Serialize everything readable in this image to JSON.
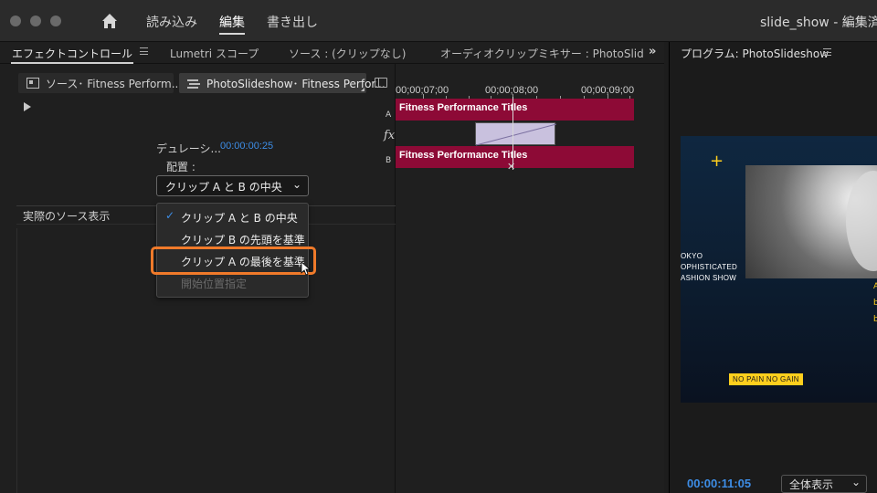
{
  "titlebar": {
    "menu": [
      "読み込み",
      "編集",
      "書き出し"
    ],
    "active_menu": "編集",
    "document_title": "slide_show - 編集済み"
  },
  "panel_tabs": {
    "effect_controls": "エフェクトコントロール",
    "lumetri": "Lumetri スコープ",
    "source": "ソース : (クリップなし)",
    "audio_mixer": "オーディオクリップミキサー : PhotoSlides"
  },
  "program": {
    "title": "プログラム: PhotoSlideshow",
    "timecode": "00:00:11:05",
    "zoom": "全体表示",
    "video_text": {
      "line1": "OKYO",
      "line2": "OPHISTICATED",
      "line3": "ASHION SHOW",
      "right1": "A",
      "right2": "b",
      "right3": "b",
      "badge": "NO PAIN NO GAIN"
    }
  },
  "effect_controls": {
    "source_tab": "ソース･ Fitness Perform...",
    "sequence_tab": "PhotoSlideshow･ Fitness Perfor...",
    "duration_label": "デュレーシ...",
    "duration_value": "00:00:00:25",
    "alignment_label": "配置 :",
    "alignment_value": "クリップ A と B の中央",
    "actual_source_label": "実際のソース表示",
    "dropdown": {
      "options": [
        "クリップ A と B の中央",
        "クリップ B の先頭を基準",
        "クリップ A の最後を基準",
        "開始位置指定"
      ],
      "checked_index": 0,
      "highlighted_index": 2,
      "disabled_index": 3
    }
  },
  "timeline": {
    "times": [
      "00;00;07;00",
      "00;00;08;00",
      "00;00;09;00"
    ],
    "track_a": "A",
    "track_b": "B",
    "fx": "fx",
    "clip_a": "Fitness Performance Titles",
    "clip_b": "Fitness Performance Titles"
  },
  "colors": {
    "accent_blue": "#3d8de6",
    "clip_magenta": "#8d0a36",
    "highlight_orange": "#f07a2a",
    "badge_yellow": "#ffcf1d"
  }
}
